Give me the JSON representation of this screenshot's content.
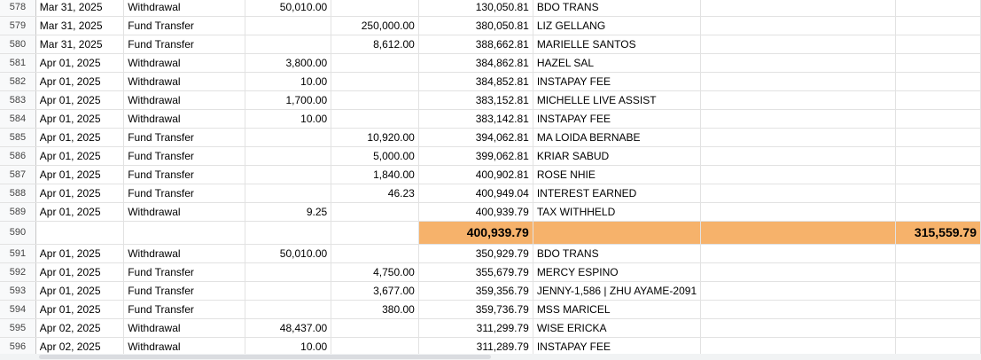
{
  "rows": [
    {
      "num": "578",
      "date": "Mar 31, 2025",
      "type": "Withdrawal",
      "debit": "50,010.00",
      "credit": "",
      "balance": "130,050.81",
      "desc": "BDO TRANS"
    },
    {
      "num": "579",
      "date": "Mar 31, 2025",
      "type": "Fund Transfer",
      "debit": "",
      "credit": "250,000.00",
      "balance": "380,050.81",
      "desc": "LIZ GELLANG"
    },
    {
      "num": "580",
      "date": "Mar 31, 2025",
      "type": "Fund Transfer",
      "debit": "",
      "credit": "8,612.00",
      "balance": "388,662.81",
      "desc": "MARIELLE SANTOS"
    },
    {
      "num": "581",
      "date": "Apr 01, 2025",
      "type": "Withdrawal",
      "debit": "3,800.00",
      "credit": "",
      "balance": "384,862.81",
      "desc": "HAZEL SAL"
    },
    {
      "num": "582",
      "date": "Apr 01, 2025",
      "type": "Withdrawal",
      "debit": "10.00",
      "credit": "",
      "balance": "384,852.81",
      "desc": "INSTAPAY FEE"
    },
    {
      "num": "583",
      "date": "Apr 01, 2025",
      "type": "Withdrawal",
      "debit": "1,700.00",
      "credit": "",
      "balance": "383,152.81",
      "desc": "MICHELLE LIVE ASSIST"
    },
    {
      "num": "584",
      "date": "Apr 01, 2025",
      "type": "Withdrawal",
      "debit": "10.00",
      "credit": "",
      "balance": "383,142.81",
      "desc": "INSTAPAY FEE"
    },
    {
      "num": "585",
      "date": "Apr 01, 2025",
      "type": "Fund Transfer",
      "debit": "",
      "credit": "10,920.00",
      "balance": "394,062.81",
      "desc": "MA LOIDA BERNABE"
    },
    {
      "num": "586",
      "date": "Apr 01, 2025",
      "type": "Fund Transfer",
      "debit": "",
      "credit": "5,000.00",
      "balance": "399,062.81",
      "desc": "KRIAR SABUD"
    },
    {
      "num": "587",
      "date": "Apr 01, 2025",
      "type": "Fund Transfer",
      "debit": "",
      "credit": "1,840.00",
      "balance": "400,902.81",
      "desc": "ROSE NHIE"
    },
    {
      "num": "588",
      "date": "Apr 01, 2025",
      "type": "Fund Transfer",
      "debit": "",
      "credit": "46.23",
      "balance": "400,949.04",
      "desc": "INTEREST EARNED"
    },
    {
      "num": "589",
      "date": "Apr 01, 2025",
      "type": "Withdrawal",
      "debit": "9.25",
      "credit": "",
      "balance": "400,939.79",
      "desc": "TAX WITHHELD"
    }
  ],
  "total_row": {
    "num": "590",
    "balance_total": "400,939.79",
    "right_total": "315,559.79"
  },
  "rows2": [
    {
      "num": "591",
      "date": "Apr 01, 2025",
      "type": "Withdrawal",
      "debit": "50,010.00",
      "credit": "",
      "balance": "350,929.79",
      "desc": "BDO TRANS"
    },
    {
      "num": "592",
      "date": "Apr 01, 2025",
      "type": "Fund Transfer",
      "debit": "",
      "credit": "4,750.00",
      "balance": "355,679.79",
      "desc": "MERCY ESPINO"
    },
    {
      "num": "593",
      "date": "Apr 01, 2025",
      "type": "Fund Transfer",
      "debit": "",
      "credit": "3,677.00",
      "balance": "359,356.79",
      "desc": "JENNY-1,586 | ZHU AYAME-2091"
    },
    {
      "num": "594",
      "date": "Apr 01, 2025",
      "type": "Fund Transfer",
      "debit": "",
      "credit": "380.00",
      "balance": "359,736.79",
      "desc": "MSS MARICEL"
    },
    {
      "num": "595",
      "date": "Apr 02, 2025",
      "type": "Withdrawal",
      "debit": "48,437.00",
      "credit": "",
      "balance": "311,299.79",
      "desc": "WISE ERICKA"
    },
    {
      "num": "596",
      "date": "Apr 02, 2025",
      "type": "Withdrawal",
      "debit": "10.00",
      "credit": "",
      "balance": "311,289.79",
      "desc": "INSTAPAY FEE"
    }
  ]
}
